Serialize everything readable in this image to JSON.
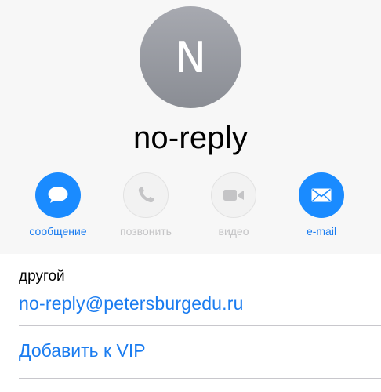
{
  "contact": {
    "initial": "N",
    "name": "no-reply"
  },
  "actions": [
    {
      "label": "сообщение",
      "icon": "message-icon",
      "enabled": true
    },
    {
      "label": "позвонить",
      "icon": "phone-icon",
      "enabled": false
    },
    {
      "label": "видео",
      "icon": "video-icon",
      "enabled": false
    },
    {
      "label": "e-mail",
      "icon": "mail-icon",
      "enabled": true
    }
  ],
  "email": {
    "type_label": "другой",
    "value": "no-reply@petersburgedu.ru"
  },
  "vip": {
    "label": "Добавить к VIP"
  },
  "colors": {
    "accent": "#1a8bff",
    "link": "#1a7cf0",
    "avatar": "#9b9da3",
    "disabled": "#c4c4c6"
  }
}
